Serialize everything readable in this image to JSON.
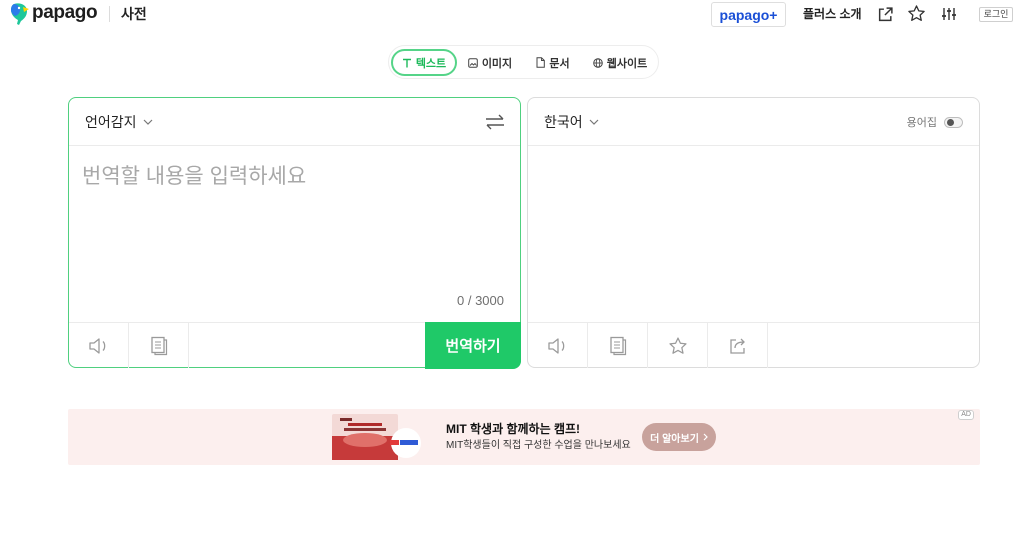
{
  "header": {
    "brand": "papago",
    "service": "사전",
    "plus_button": "papago+",
    "plus_intro": "플러스 소개",
    "login": "로그인",
    "icons": [
      "papago-logo-icon",
      "external-link-icon",
      "star-icon",
      "settings-sliders-icon"
    ]
  },
  "modes": [
    {
      "label": "텍스트",
      "icon": "text-icon",
      "active": true
    },
    {
      "label": "이미지",
      "icon": "image-icon",
      "active": false
    },
    {
      "label": "문서",
      "icon": "document-icon",
      "active": false
    },
    {
      "label": "웹사이트",
      "icon": "globe-icon",
      "active": false
    }
  ],
  "source": {
    "language": "언어감지",
    "placeholder": "번역할 내용을 입력하세요",
    "char_count": "0 / 3000",
    "translate_button": "번역하기",
    "icons": [
      "chevron-down-icon",
      "swap-icon",
      "speaker-icon",
      "book-icon"
    ]
  },
  "target": {
    "language": "한국어",
    "glossary": "용어집",
    "glossary_enabled": false,
    "icons": [
      "chevron-down-icon",
      "speaker-icon",
      "book-icon",
      "star-icon",
      "share-icon"
    ]
  },
  "ad": {
    "title": "MIT 학생과 함께하는 캠프!",
    "subtitle": "MIT학생들이 직접 구성한 수업을 만나보세요",
    "cta": "더 알아보기",
    "badge": "AD",
    "icons": [
      "chevron-right-icon"
    ]
  },
  "colors": {
    "accent_green": "#1fc968",
    "active_tab_border": "#55d488",
    "source_panel_border": "#4fd07f",
    "plus_blue": "#1a4fd6",
    "ad_background": "#fcefee",
    "ad_button": "#c8a29c"
  }
}
